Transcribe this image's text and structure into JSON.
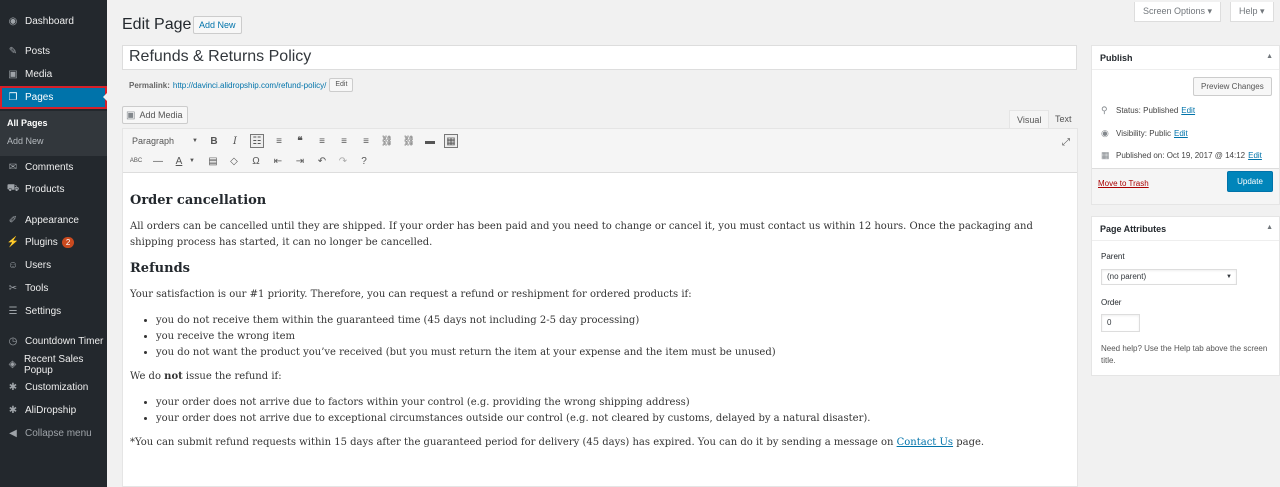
{
  "sidebar": {
    "items": [
      {
        "label": "Dashboard",
        "icon": "dashboard-icon"
      },
      {
        "label": "Posts",
        "icon": "pin-icon"
      },
      {
        "label": "Media",
        "icon": "media-icon"
      },
      {
        "label": "Pages",
        "icon": "pages-icon"
      },
      {
        "label": "Comments",
        "icon": "comment-icon"
      },
      {
        "label": "Products",
        "icon": "cart-icon"
      },
      {
        "label": "Appearance",
        "icon": "brush-icon"
      },
      {
        "label": "Plugins",
        "icon": "plug-icon",
        "badge": "2"
      },
      {
        "label": "Users",
        "icon": "user-icon"
      },
      {
        "label": "Tools",
        "icon": "wrench-icon"
      },
      {
        "label": "Settings",
        "icon": "settings-icon"
      },
      {
        "label": "Countdown Timer",
        "icon": "clock-icon"
      },
      {
        "label": "Recent Sales Popup",
        "icon": "megaphone-icon"
      },
      {
        "label": "Customization",
        "icon": "gear-icon"
      },
      {
        "label": "AliDropship",
        "icon": "gear-icon"
      },
      {
        "label": "Collapse menu",
        "icon": "collapse-icon"
      }
    ],
    "submenu": [
      "All Pages",
      "Add New"
    ]
  },
  "header": {
    "title": "Edit Page",
    "add_new": "Add New",
    "screen_options": "Screen Options ▾",
    "help": "Help ▾"
  },
  "post": {
    "title": "Refunds & Returns Policy",
    "permalink_label": "Permalink:",
    "permalink_url": "http://davinci.alidropship.com/refund-policy/",
    "permalink_edit": "Edit"
  },
  "editor": {
    "add_media": "Add Media",
    "tab_visual": "Visual",
    "tab_text": "Text",
    "format": "Paragraph"
  },
  "content": {
    "h1": "Order cancellation",
    "p1": "All orders can be cancelled until they are shipped. If your order has been paid and you need to change or cancel it, you must contact us within 12 hours. Once the packaging and shipping process has started, it can no longer be cancelled.",
    "h2": "Refunds",
    "p2": "Your satisfaction is our #1 priority. Therefore, you can request a refund or reshipment for ordered products if:",
    "list1": [
      "you do not receive them within the guaranteed time (45 days not including 2-5 day processing)",
      "you receive the wrong item",
      "you do not want the product you’ve received (but you must return the item at your expense and the item must be unused)"
    ],
    "p3_pre": "We do ",
    "p3_bold": "not",
    "p3_post": " issue the refund if:",
    "list2": [
      "your order does not arrive due to factors within your control (e.g. providing the wrong shipping address)",
      "your order does not arrive due to exceptional circumstances outside our control (e.g. not cleared by customs, delayed by a natural disaster)."
    ],
    "p4_pre": "*You can submit refund requests within 15 days after the guaranteed period for delivery (45 days) has expired. You can do it by sending a message on ",
    "p4_link": "Contact Us",
    "p4_post": " page."
  },
  "publish": {
    "title": "Publish",
    "preview": "Preview Changes",
    "status_label": "Status: Published",
    "visibility_label": "Visibility: Public",
    "published_label": "Published on: Oct 19, 2017 @ 14:12",
    "edit": "Edit",
    "trash": "Move to Trash",
    "update": "Update"
  },
  "attributes": {
    "title": "Page Attributes",
    "parent_label": "Parent",
    "parent_value": "(no parent)",
    "order_label": "Order",
    "order_value": "0",
    "help": "Need help? Use the Help tab above the screen title."
  },
  "colors": {
    "sidebar_bg": "#23282d",
    "accent": "#0073aa",
    "highlight": "#d6202a",
    "update_button": "#0085ba"
  }
}
